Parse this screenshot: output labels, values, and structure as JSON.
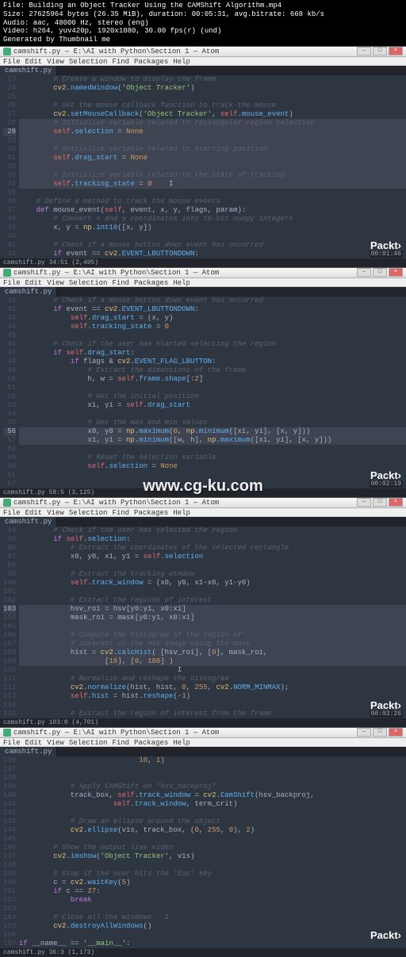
{
  "meta": {
    "file": "File: Building an Object Tracker Using the CAMShift Algorithm.mp4",
    "size": "Size: 27625964 bytes (26.35 MiB), duration: 00:05:31, avg.bitrate: 668 kb/s",
    "audio": "Audio: aac, 48000 Hz, stereo (eng)",
    "video": "Video: h264, yuv420p, 1920x1080, 30.00 fps(r) (und)",
    "gen": "Generated by Thumbnail me"
  },
  "watermark": "www.cg-ku.com",
  "logo": "Packt",
  "menus": [
    "File",
    "Edit",
    "View",
    "Selection",
    "Find",
    "Packages",
    "Help"
  ],
  "win_title": "camshift.py — E:\\AI with Python\\Section 1 — Atom",
  "tab": "camshift.py",
  "panes": [
    {
      "lines": [
        {
          "n": 23,
          "t": "        # Create a window to display the frame",
          "cls": "c"
        },
        {
          "n": 24,
          "t": "        cv2.namedWindow('Object Tracker')",
          "cls": ""
        },
        {
          "n": 25,
          "t": "",
          "cls": ""
        },
        {
          "n": 26,
          "t": "        # Set the mouse callback function to track the mouse",
          "cls": "c"
        },
        {
          "n": 27,
          "t": "        cv2.setMouseCallback('Object Tracker', self.mouse_event)",
          "cls": ""
        },
        {
          "n": 28,
          "t": "        # Initialize variable related to rectangular region selection",
          "cls": "c sel"
        },
        {
          "n": 28,
          "t": "        self.selection = None",
          "cls": "sel",
          "active": true
        },
        {
          "n": 29,
          "t": "",
          "cls": "sel"
        },
        {
          "n": 30,
          "t": "        # Initialize variable related to starting position",
          "cls": "c sel"
        },
        {
          "n": 31,
          "t": "        self.drag_start = None",
          "cls": "sel"
        },
        {
          "n": 32,
          "t": "",
          "cls": "sel"
        },
        {
          "n": 33,
          "t": "        # Initialize variable related to the state of tracking",
          "cls": "c sel"
        },
        {
          "n": 34,
          "t": "        self.tracking_state = 0    I",
          "cls": "sel"
        },
        {
          "n": 35,
          "t": "",
          "cls": ""
        },
        {
          "n": 36,
          "t": "    # Define a method to track the mouse events",
          "cls": "c"
        },
        {
          "n": 37,
          "t": "    def mouse_event(self, event, x, y, flags, param):",
          "cls": ""
        },
        {
          "n": 38,
          "t": "        # Convert x and y coordinates into 16-bit numpy integers",
          "cls": "c"
        },
        {
          "n": 39,
          "t": "        x, y = np.int16([x, y])",
          "cls": ""
        },
        {
          "n": 40,
          "t": "",
          "cls": ""
        },
        {
          "n": 41,
          "t": "        # Check if a mouse button down event has occurred",
          "cls": "c"
        },
        {
          "n": 42,
          "t": "        if event == cv2.EVENT_LBUTTONDOWN:",
          "cls": ""
        }
      ],
      "status_left": "camshift.py    34:51   (2,495)",
      "timestamp": "00:01:46"
    },
    {
      "lines": [
        {
          "n": 41,
          "t": "        # Check if a mouse button down event has occurred",
          "cls": "c"
        },
        {
          "n": 42,
          "t": "        if event == cv2.EVENT_LBUTTONDOWN:",
          "cls": ""
        },
        {
          "n": 43,
          "t": "            self.drag_start = (x, y)",
          "cls": ""
        },
        {
          "n": 44,
          "t": "            self.tracking_state = 0",
          "cls": ""
        },
        {
          "n": 45,
          "t": "",
          "cls": ""
        },
        {
          "n": 46,
          "t": "        # Check if the user has started selecting the region",
          "cls": "c"
        },
        {
          "n": 47,
          "t": "        if self.drag_start:",
          "cls": ""
        },
        {
          "n": 48,
          "t": "            if flags & cv2.EVENT_FLAG_LBUTTON:",
          "cls": ""
        },
        {
          "n": 49,
          "t": "                # Extract the dimensions of the frame",
          "cls": "c"
        },
        {
          "n": 50,
          "t": "                h, w = self.frame.shape[:2]",
          "cls": ""
        },
        {
          "n": 51,
          "t": "",
          "cls": ""
        },
        {
          "n": 52,
          "t": "                # Get the initial position",
          "cls": "c"
        },
        {
          "n": 53,
          "t": "                xi, yi = self.drag_start",
          "cls": ""
        },
        {
          "n": 54,
          "t": "",
          "cls": ""
        },
        {
          "n": 55,
          "t": "                # Get the max and min values",
          "cls": "c"
        },
        {
          "n": 56,
          "t": "                x0, y0 = np.maximum(0, np.minimum([xi, yi], [x, y]))",
          "cls": "sel",
          "active": true
        },
        {
          "n": 57,
          "t": "                x1, y1 = np.minimum([w, h], np.maximum([xi, yi], [x, y]))",
          "cls": "sel"
        },
        {
          "n": 58,
          "t": "",
          "cls": ""
        },
        {
          "n": 59,
          "t": "                # Reset the selection variable",
          "cls": "c"
        },
        {
          "n": 60,
          "t": "                self.selection = None",
          "cls": ""
        },
        {
          "n": 61,
          "t": "",
          "cls": ""
        },
        {
          "n": 62,
          "t": "",
          "cls": ""
        }
      ],
      "status_left": "camshift.py    58:5    (3,125)",
      "timestamp": "00:02:19"
    },
    {
      "lines": [
        {
          "n": 94,
          "t": "        # Check if the user has selected the region",
          "cls": "c"
        },
        {
          "n": 95,
          "t": "        if self.selection:",
          "cls": ""
        },
        {
          "n": 96,
          "t": "            # Extract the coordinates of the selected rectangle",
          "cls": "c"
        },
        {
          "n": 97,
          "t": "            x0, y0, x1, y1 = self.selection",
          "cls": ""
        },
        {
          "n": 98,
          "t": "",
          "cls": ""
        },
        {
          "n": 99,
          "t": "            # Extract the tracking window",
          "cls": "c"
        },
        {
          "n": 100,
          "t": "            self.track_window = (x0, y0, x1-x0, y1-y0)",
          "cls": ""
        },
        {
          "n": 101,
          "t": "",
          "cls": ""
        },
        {
          "n": 102,
          "t": "            # Extract the regions of interest",
          "cls": "c"
        },
        {
          "n": 103,
          "t": "            hsv_roi = hsv[y0:y1, x0:x1]",
          "cls": "sel",
          "active": true
        },
        {
          "n": 104,
          "t": "            mask_roi = mask[y0:y1, x0:x1]",
          "cls": "sel"
        },
        {
          "n": 105,
          "t": "",
          "cls": "sel"
        },
        {
          "n": 106,
          "t": "            # Compute the histogram of the region of",
          "cls": "c sel"
        },
        {
          "n": 107,
          "t": "            # interest in the HSV image using the mask",
          "cls": "c sel"
        },
        {
          "n": 108,
          "t": "            hist = cv2.calcHist( [hsv_roi], [0], mask_roi,",
          "cls": "sel"
        },
        {
          "n": 109,
          "t": "                    [16], [0, 180] )",
          "cls": "sel"
        },
        {
          "n": 110,
          "t": "                                     I",
          "cls": ""
        },
        {
          "n": 111,
          "t": "            # Normalize and reshape the histogram",
          "cls": "c"
        },
        {
          "n": 112,
          "t": "            cv2.normalize(hist, hist, 0, 255, cv2.NORM_MINMAX);",
          "cls": ""
        },
        {
          "n": 113,
          "t": "            self.hist = hist.reshape(-1)",
          "cls": ""
        },
        {
          "n": 114,
          "t": "",
          "cls": ""
        },
        {
          "n": 115,
          "t": "            # Extract the region of interest from the frame",
          "cls": "c"
        }
      ],
      "status_left": "camshift.py    103:0    (4,701)",
      "timestamp": "00:03:26"
    },
    {
      "lines": [
        {
          "n": 136,
          "t": "                            10, 1)",
          "cls": ""
        },
        {
          "n": 137,
          "t": "",
          "cls": ""
        },
        {
          "n": 138,
          "t": "",
          "cls": ""
        },
        {
          "n": 139,
          "t": "            # Apply CAMShift on \"hsv_backproj\"",
          "cls": "c"
        },
        {
          "n": 140,
          "t": "            track_box, self.track_window = cv2.CamShift(hsv_backproj,",
          "cls": ""
        },
        {
          "n": 141,
          "t": "                      self.track_window, term_crit)",
          "cls": ""
        },
        {
          "n": 142,
          "t": "",
          "cls": ""
        },
        {
          "n": 143,
          "t": "            # Draw an ellipse around the object",
          "cls": "c"
        },
        {
          "n": 144,
          "t": "            cv2.ellipse(vis, track_box, (0, 255, 0), 2)",
          "cls": ""
        },
        {
          "n": 145,
          "t": "",
          "cls": ""
        },
        {
          "n": 146,
          "t": "        # Show the output live video",
          "cls": "c"
        },
        {
          "n": 147,
          "t": "        cv2.imshow('Object Tracker', vis)",
          "cls": ""
        },
        {
          "n": 148,
          "t": "",
          "cls": ""
        },
        {
          "n": 149,
          "t": "        # Stop if the user hits the 'Esc' key",
          "cls": "c"
        },
        {
          "n": 150,
          "t": "        c = cv2.waitKey(5)",
          "cls": ""
        },
        {
          "n": 151,
          "t": "        if c == 27:",
          "cls": ""
        },
        {
          "n": 152,
          "t": "            break",
          "cls": ""
        },
        {
          "n": 153,
          "t": "",
          "cls": ""
        },
        {
          "n": 154,
          "t": "        # Close all the windows   I",
          "cls": "c"
        },
        {
          "n": 155,
          "t": "        cv2.destroyAllWindows()",
          "cls": ""
        },
        {
          "n": 156,
          "t": "",
          "cls": ""
        },
        {
          "n": 157,
          "t": "if __name__ == '__main__':",
          "cls": ""
        }
      ],
      "status_left": "camshift.py    36:3    (1,173)",
      "timestamp": ""
    }
  ]
}
